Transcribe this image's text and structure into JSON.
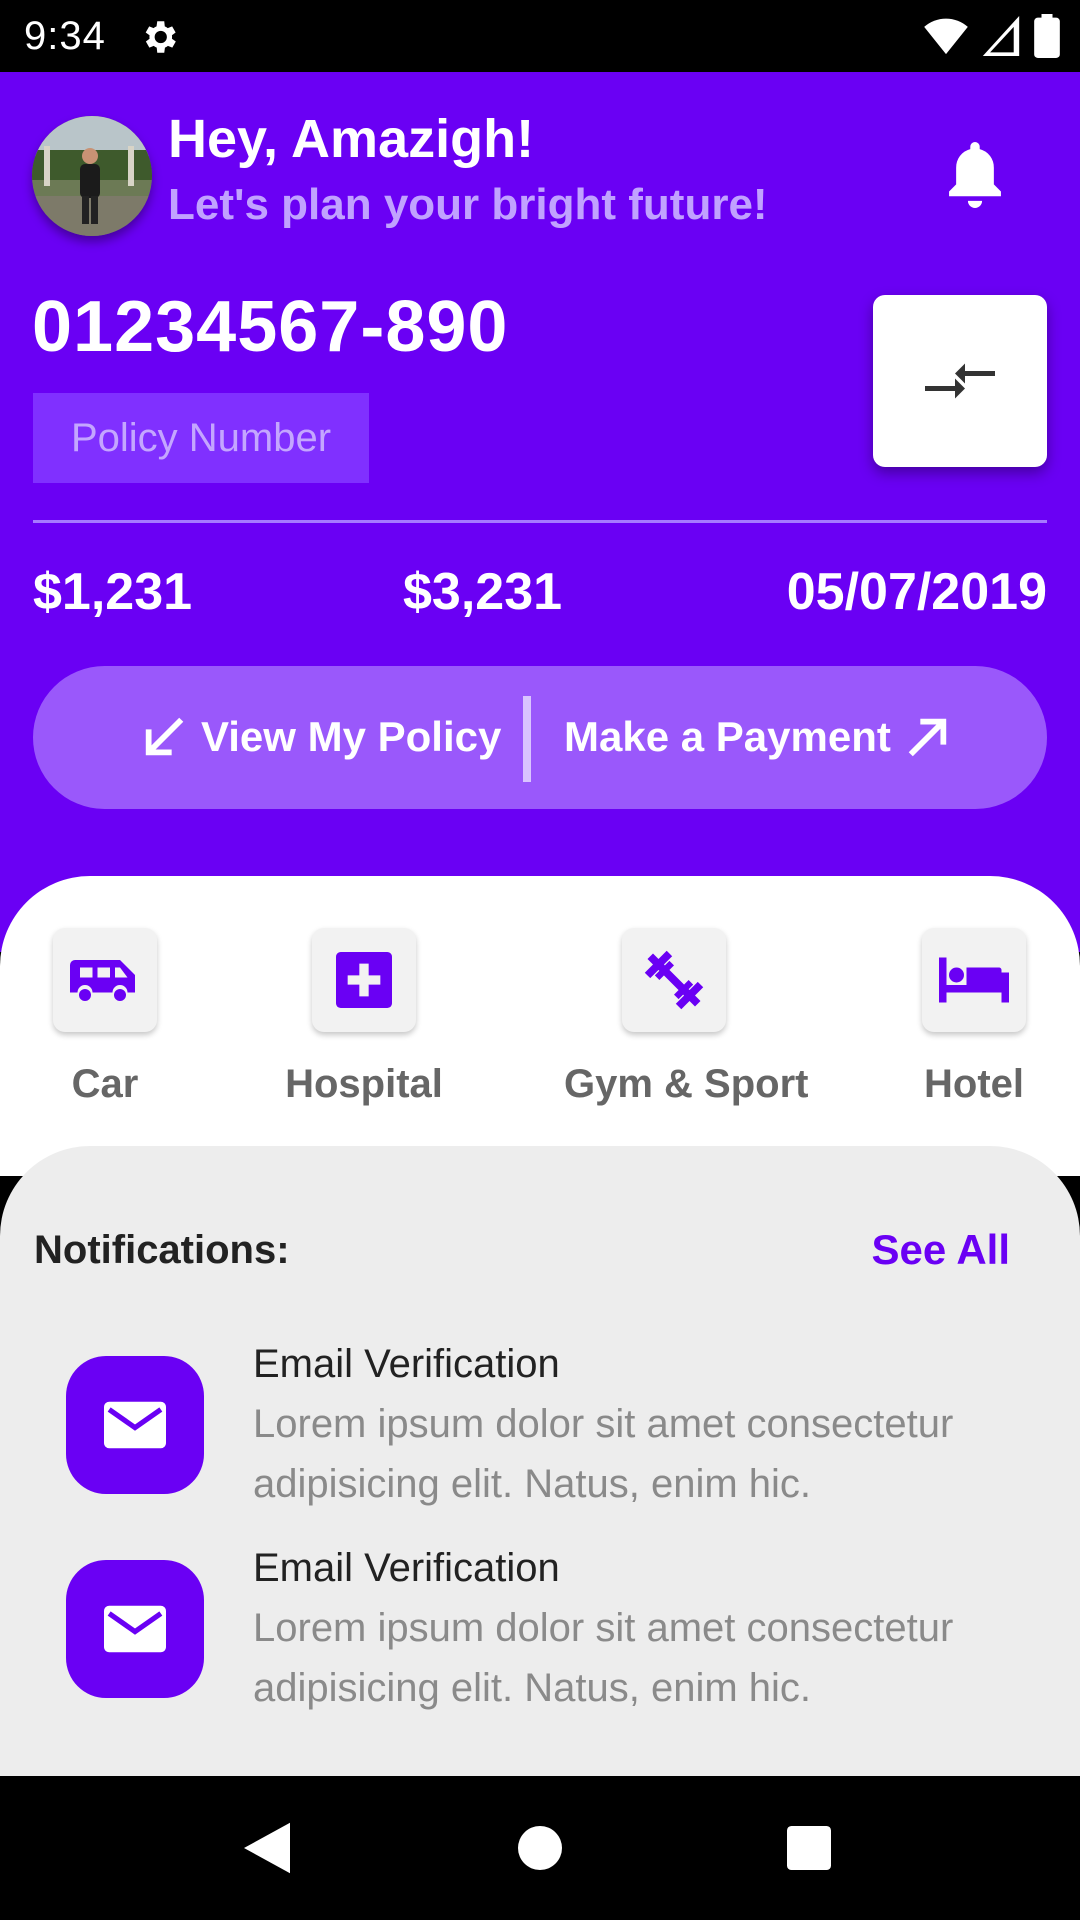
{
  "status_bar": {
    "time": "9:34"
  },
  "header": {
    "greeting": "Hey, Amazigh!",
    "subtitle": "Let's plan your bright future!"
  },
  "policy": {
    "number": "01234567-890",
    "label": "Policy Number"
  },
  "amounts": [
    "$1,231",
    "$3,231",
    "05/07/2019"
  ],
  "actions": {
    "view_policy": "View My Policy",
    "make_payment": "Make a Payment"
  },
  "categories": [
    {
      "label": "Car",
      "icon": "van-icon"
    },
    {
      "label": "Hospital",
      "icon": "hospital-icon"
    },
    {
      "label": "Gym & Sport",
      "icon": "dumbbell-icon"
    },
    {
      "label": "Hotel",
      "icon": "bed-icon"
    }
  ],
  "notifications": {
    "title": "Notifications:",
    "see_all": "See All",
    "items": [
      {
        "title": "Email Verification",
        "body": "Lorem ipsum dolor sit amet consectetur adipisicing elit. Natus, enim hic."
      },
      {
        "title": "Email Verification",
        "body": "Lorem ipsum dolor sit amet consectetur adipisicing elit. Natus, enim hic."
      }
    ]
  },
  "colors": {
    "primary": "#6a00f4",
    "pill": "#9a58fb",
    "panel": "#ededed"
  }
}
